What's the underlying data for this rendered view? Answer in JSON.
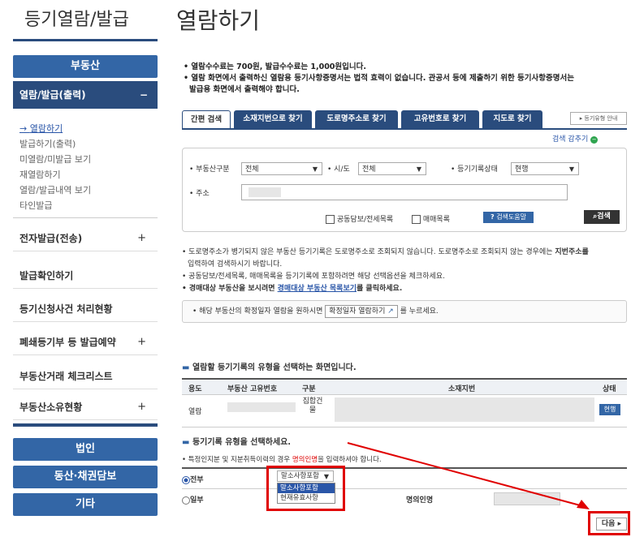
{
  "sidebar": {
    "title": "등기열람/발급",
    "category_realestate": "부동산",
    "open_menu": "열람/발급(출력)",
    "sub_items": [
      "열람하기",
      "발급하기(출력)",
      "미열람/미발급 보기",
      "재열람하기",
      "열람/발급내역 보기",
      "타인발급"
    ],
    "menu_rows": [
      {
        "label": "전자발급(전송)",
        "plus": "+"
      },
      {
        "label": "발급확인하기",
        "plus": ""
      },
      {
        "label": "등기신청사건 처리현황",
        "plus": ""
      },
      {
        "label": "폐쇄등기부 등 발급예약",
        "plus": "+"
      },
      {
        "label": "부동산거래 체크리스트",
        "plus": ""
      },
      {
        "label": "부동산소유현황",
        "plus": "+"
      }
    ],
    "buttons": [
      "법인",
      "동산·채권담보",
      "기타"
    ]
  },
  "page": {
    "title": "열람하기",
    "notice1": "• 열람수수료는 700원, 발급수수료는 1,000원입니다.",
    "notice2": "• 열람 화면에서 출력하신 열람용 등기사항증명서는 법적 효력이 없습니다. 관공서 등에 제출하기 위한 등기사항증명서는",
    "notice3": "발급용 화면에서 출력해야 합니다."
  },
  "tabs": [
    "간편 검색",
    "소재지번으로 찾기",
    "도로명주소로 찾기",
    "고유번호로 찾기",
    "지도로 찾기"
  ],
  "guide_link": "▸ 등기유형 안내",
  "search_collapse": "검색 감추기",
  "form": {
    "type_label": "• 부동산구분",
    "type_value": "전체",
    "region_label": "• 시/도",
    "region_value": "전체",
    "status_label": "• 등기기록상태",
    "status_value": "현행",
    "address_label": "• 주소",
    "chk_collateral": "공동담보/전세목록",
    "chk_trade": "매매목록",
    "help_label": "검색도움말",
    "search_label": "검색"
  },
  "info": {
    "line1": "• 도로명주소가 병기되지 않은 부동산 등기기록은 도로명주소로 조회되지 않습니다. 도로명주소로 조회되지 않는 경우에는",
    "line1_bold": "지번주소를",
    "line2": "입력하여 검색하시기 바랍니다.",
    "line3": "• 공동담보/전세목록, 매매목록을 등기기록에 포함하려면 해당 선택옵션을 체크하세요.",
    "line4_a": "• 경매대상 부동산을 보시려면",
    "line4_link": "경매대상 부동산 목록보기",
    "line4_b": "를 클릭하세요.",
    "date_pre": "• 해당 부동산의 확정일자 열람을 원하시면",
    "date_btn": "확정일자 열람하기",
    "date_post": "를 누르세요."
  },
  "section1": {
    "title": "열람할 등기기록의 유형을 선택하는 화면입니다.",
    "headers": [
      "용도",
      "부동산 고유번호",
      "구분",
      "소재지번",
      "상태"
    ],
    "row": {
      "use": "열람",
      "type": "집합건물",
      "status": "현행"
    }
  },
  "section2": {
    "title": "등기기록 유형을 선택하세요.",
    "note_a": "• 특정인지분 및 지분취득이력의 경우",
    "note_red": "명의인명",
    "note_b": "을 입력하셔야 합니다.",
    "all_label": "전부",
    "part_label": "일부",
    "dropdown_value": "말소사항포함",
    "options": [
      "말소사항포함",
      "현재유효사항"
    ],
    "name_label": "명의인명"
  },
  "next_label": "다음",
  "colors": {
    "primary": "#3366a6",
    "dark": "#2a4c7d",
    "highlight": "#e00000",
    "green": "#2ea44f"
  }
}
